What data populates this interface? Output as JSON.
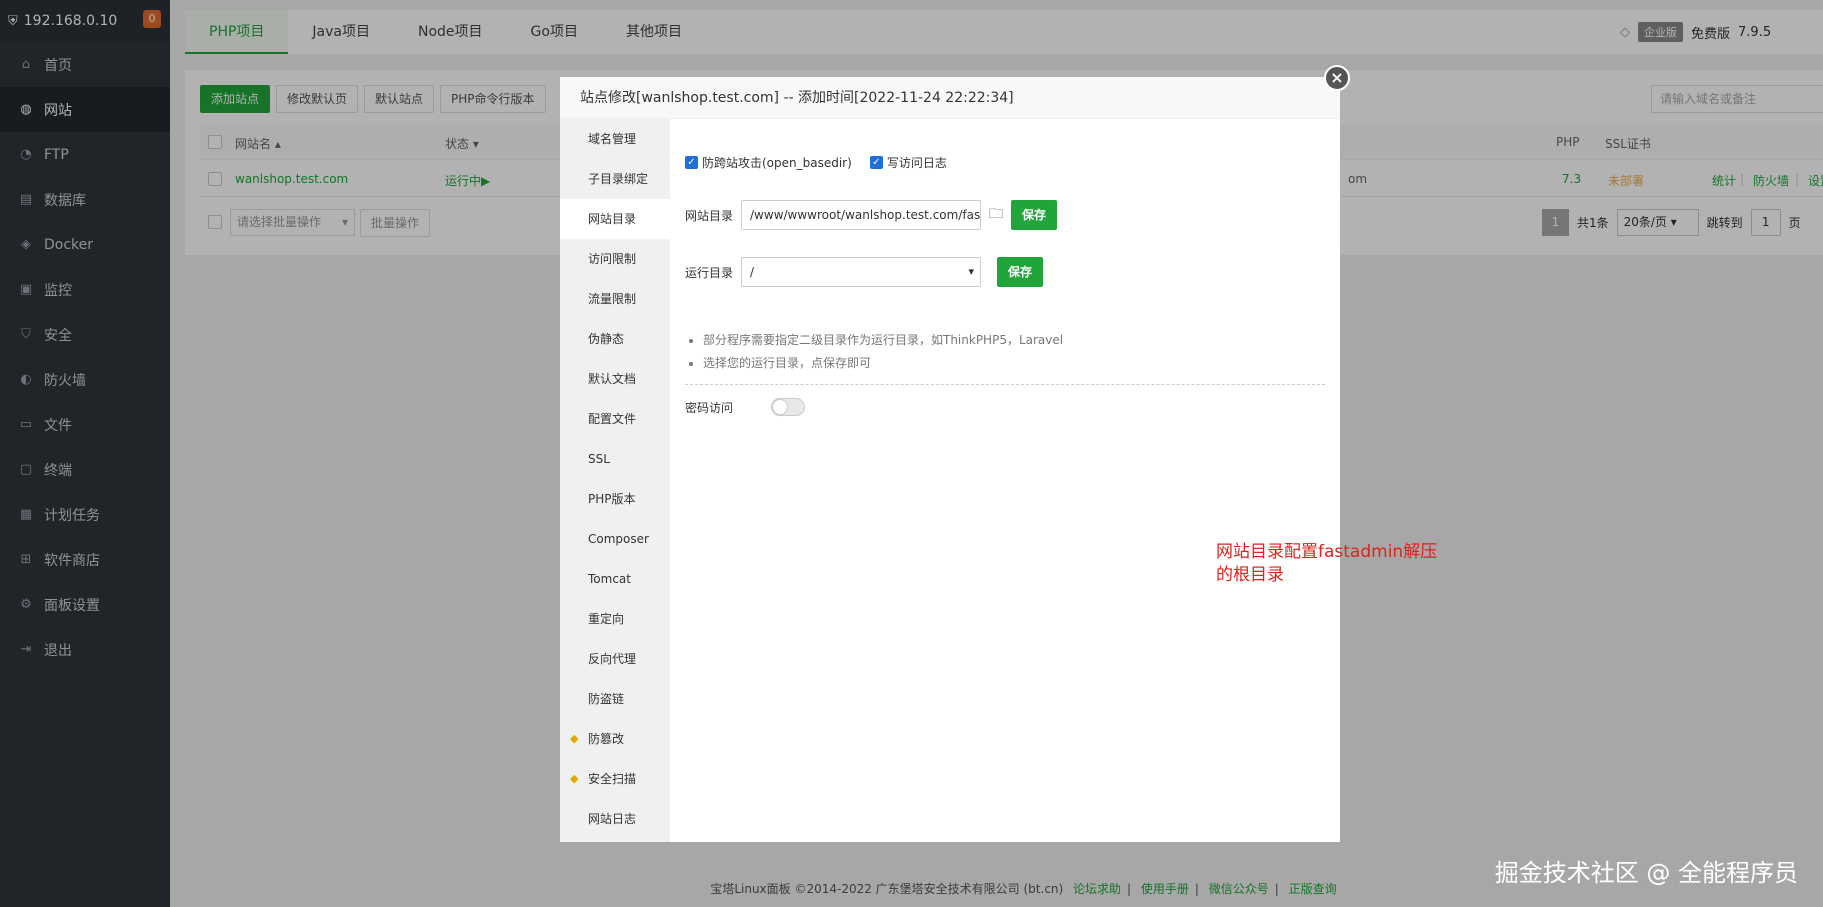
{
  "sidebar": {
    "ip": "192.168.0.10",
    "badge": "0",
    "items": [
      {
        "label": "首页",
        "icon": "home-icon"
      },
      {
        "label": "网站",
        "icon": "globe-icon"
      },
      {
        "label": "FTP",
        "icon": "ftp-icon"
      },
      {
        "label": "数据库",
        "icon": "database-icon"
      },
      {
        "label": "Docker",
        "icon": "docker-icon"
      },
      {
        "label": "监控",
        "icon": "monitor-icon"
      },
      {
        "label": "安全",
        "icon": "shield-icon"
      },
      {
        "label": "防火墙",
        "icon": "firewall-icon"
      },
      {
        "label": "文件",
        "icon": "folder-icon"
      },
      {
        "label": "终端",
        "icon": "terminal-icon"
      },
      {
        "label": "计划任务",
        "icon": "calendar-icon"
      },
      {
        "label": "软件商店",
        "icon": "apps-icon"
      },
      {
        "label": "面板设置",
        "icon": "gear-icon"
      },
      {
        "label": "退出",
        "icon": "logout-icon"
      }
    ]
  },
  "top_tabs": [
    "PHP项目",
    "Java项目",
    "Node项目",
    "Go项目",
    "其他项目"
  ],
  "top_right": {
    "enterprise": "企业版",
    "free": "免费版",
    "version": "7.9.5"
  },
  "toolbar": {
    "add_site": "添加站点",
    "edit_default": "修改默认页",
    "default_site": "默认站点",
    "php_cli": "PHP命令行版本",
    "search_placeholder": "请输入域名或备注"
  },
  "table": {
    "headers": {
      "name": "网站名",
      "status": "状态",
      "php": "PHP",
      "ssl": "SSL证书"
    },
    "row": {
      "name": "wanlshop.test.com",
      "status": "运行中▶",
      "domain_tail": "om",
      "php": "7.3",
      "ssl": "未部署",
      "actions": [
        "统计",
        "防火墙",
        "设置"
      ]
    }
  },
  "batch": {
    "select_placeholder": "请选择批量操作",
    "button": "批量操作"
  },
  "pagination": {
    "current": "1",
    "total": "共1条",
    "per_page": "20条/页",
    "jump_label": "跳转到",
    "jump_value": "1",
    "page_unit": "页"
  },
  "footer": {
    "copyright": "宝塔Linux面板 ©2014-2022 广东堡塔安全技术有限公司 (bt.cn)",
    "links": [
      "论坛求助",
      "使用手册",
      "微信公众号",
      "正版查询"
    ]
  },
  "watermark": "掘金技术社区 @ 全能程序员",
  "modal": {
    "title": "站点修改[wanlshop.test.com] -- 添加时间[2022-11-24 22:22:34]",
    "close": "×",
    "nav": [
      "域名管理",
      "子目录绑定",
      "网站目录",
      "访问限制",
      "流量限制",
      "伪静态",
      "默认文档",
      "配置文件",
      "SSL",
      "PHP版本",
      "Composer",
      "Tomcat",
      "重定向",
      "反向代理",
      "防盗链",
      "防篡改",
      "安全扫描",
      "网站日志"
    ],
    "checkbox1": "防跨站攻击(open_basedir)",
    "checkbox2": "写访问日志",
    "dir_label": "网站目录",
    "dir_value": "/www/wwwroot/wanlshop.test.com/fast",
    "save": "保存",
    "run_label": "运行目录",
    "run_value": "/",
    "tips": [
      "部分程序需要指定二级目录作为运行目录，如ThinkPHP5，Laravel",
      "选择您的运行目录，点保存即可"
    ],
    "password_label": "密码访问",
    "annotation_line1": "网站目录配置fastadmin解压",
    "annotation_line2": "的根目录"
  }
}
